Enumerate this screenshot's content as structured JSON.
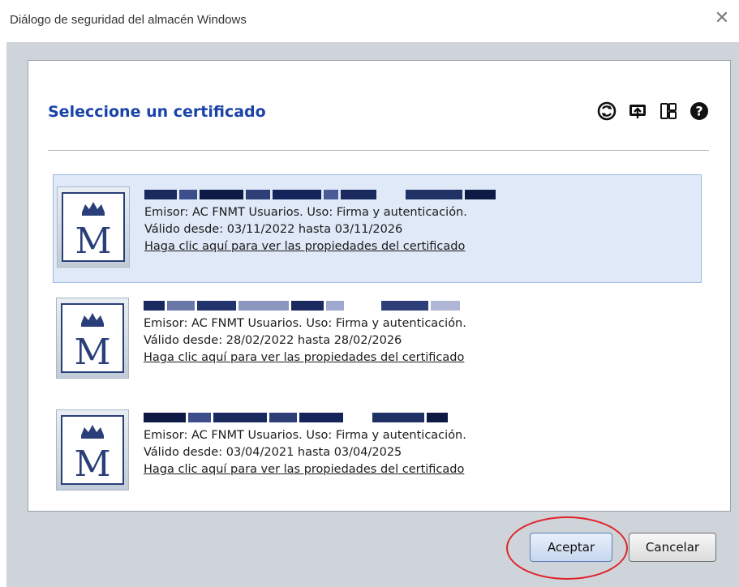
{
  "window": {
    "title": "Diálogo de seguridad del almacén Windows",
    "close_icon": "close-icon"
  },
  "panel": {
    "title": "Seleccione un certificado",
    "toolbar_icons": [
      "refresh-icon",
      "import-icon",
      "view-details-icon",
      "help-icon"
    ]
  },
  "certificates": [
    {
      "name": "",
      "selected": true,
      "issuer_line": "Emisor: AC FNMT Usuarios. Uso: Firma y autenticación.",
      "validity_line": "Válido desde: 03/11/2022 hasta 03/11/2026",
      "link": "Haga clic aquí para ver las propiedades del certificado"
    },
    {
      "name": "",
      "selected": false,
      "issuer_line": "Emisor: AC FNMT Usuarios. Uso: Firma y autenticación.",
      "validity_line": "Válido desde: 28/02/2022 hasta 28/02/2026",
      "link": "Haga clic aquí para ver las propiedades del certificado"
    },
    {
      "name": "",
      "selected": false,
      "issuer_line": "Emisor: AC FNMT Usuarios. Uso: Firma y autenticación.",
      "validity_line": "Válido desde: 03/04/2021 hasta 03/04/2025",
      "link": "Haga clic aquí para ver las propiedades del certificado"
    }
  ],
  "buttons": {
    "accept": "Aceptar",
    "cancel": "Cancelar"
  },
  "colors": {
    "accent": "#1a43a8",
    "selected_bg": "#dfe9f7",
    "annotation": "#e0232a"
  }
}
